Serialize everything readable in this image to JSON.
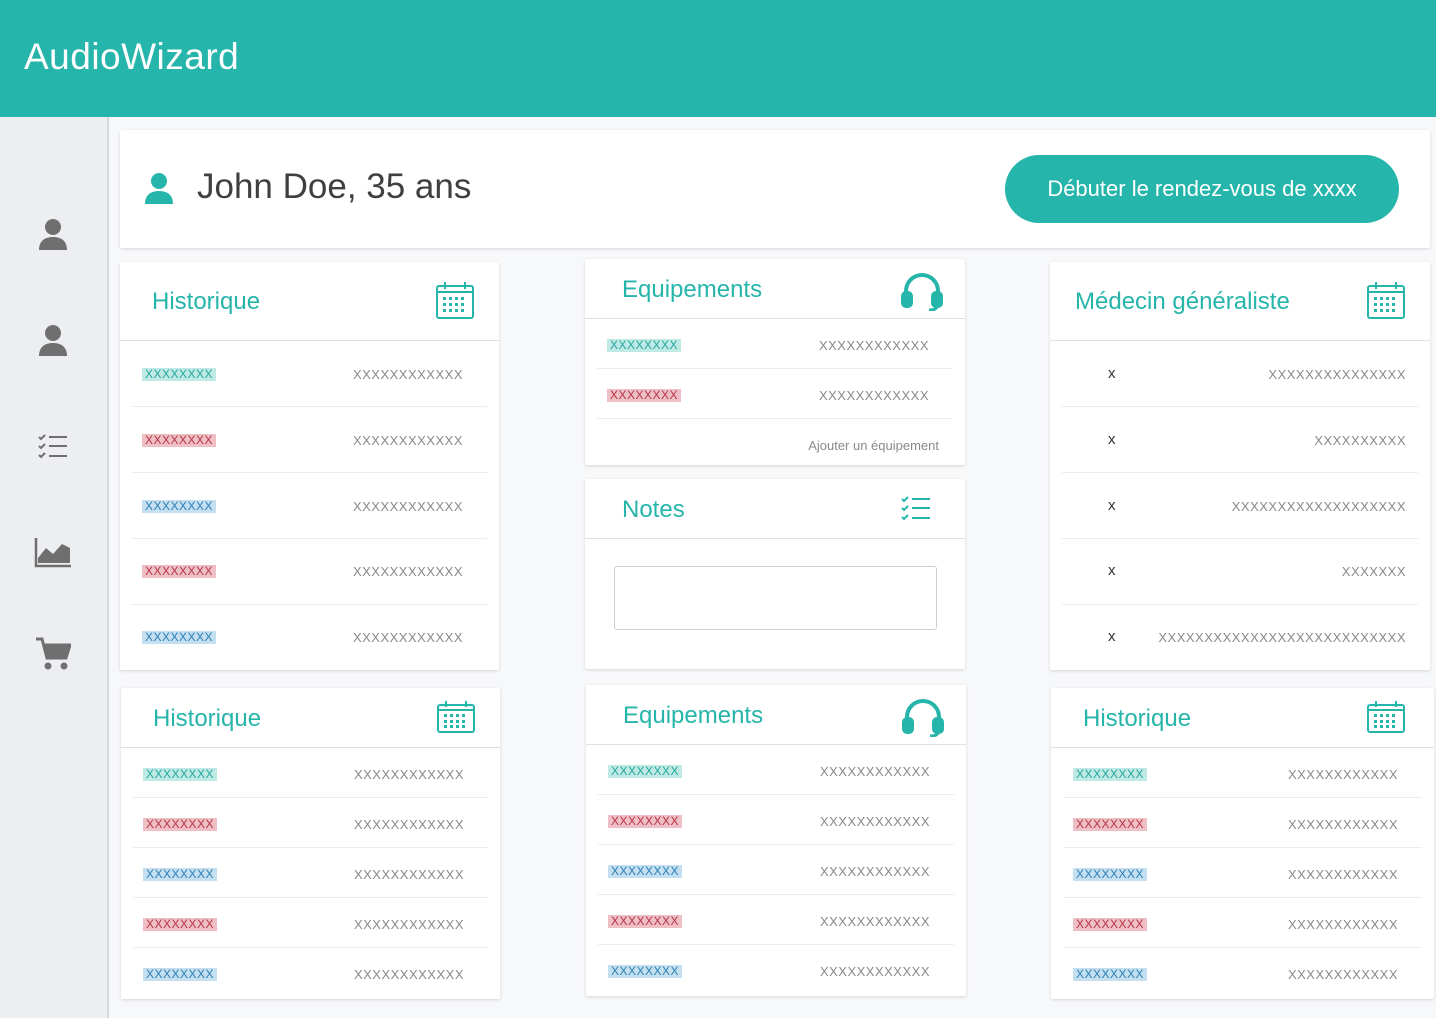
{
  "app": {
    "title": "AudioWizard"
  },
  "colors": {
    "accent": "#26b5aa",
    "tag_teal": "#24a79c",
    "tag_red": "#b83346",
    "tag_blue": "#2c7fb6"
  },
  "sidebar": {
    "items": [
      {
        "icon": "person-icon"
      },
      {
        "icon": "person-icon"
      },
      {
        "icon": "checklist-icon"
      },
      {
        "icon": "area-chart-icon"
      },
      {
        "icon": "cart-icon"
      }
    ]
  },
  "patient": {
    "name": "John Doe, 35 ans",
    "start_button": "Débuter le rendez-vous de xxxx"
  },
  "historique_top": {
    "title": "Historique",
    "rows": [
      {
        "tag": "XXXXXXXX",
        "color": "teal",
        "value": "XXXXXXXXXXXX"
      },
      {
        "tag": "XXXXXXXX",
        "color": "red",
        "value": "XXXXXXXXXXXX"
      },
      {
        "tag": "XXXXXXXX",
        "color": "blue",
        "value": "XXXXXXXXXXXX"
      },
      {
        "tag": "XXXXXXXX",
        "color": "red",
        "value": "XXXXXXXXXXXX"
      },
      {
        "tag": "XXXXXXXX",
        "color": "blue",
        "value": "XXXXXXXXXXXX"
      }
    ]
  },
  "equipements_top": {
    "title": "Equipements",
    "rows": [
      {
        "tag": "XXXXXXXX",
        "color": "teal",
        "value": "XXXXXXXXXXXX"
      },
      {
        "tag": "XXXXXXXX",
        "color": "red",
        "value": "XXXXXXXXXXXX"
      }
    ],
    "add_label": "Ajouter un équipement"
  },
  "notes": {
    "title": "Notes",
    "value": ""
  },
  "medecin": {
    "title": "Médecin généraliste",
    "rows": [
      {
        "label": "x",
        "value": "XXXXXXXXXXXXXXX"
      },
      {
        "label": "x",
        "value": "XXXXXXXXXX"
      },
      {
        "label": "x",
        "value": "XXXXXXXXXXXXXXXXXXX"
      },
      {
        "label": "x",
        "value": "XXXXXXX"
      },
      {
        "label": "x",
        "value": "XXXXXXXXXXXXXXXXXXXXXXXXXXX"
      }
    ]
  },
  "historique_bl": {
    "title": "Historique",
    "rows": [
      {
        "tag": "XXXXXXXX",
        "color": "teal",
        "value": "XXXXXXXXXXXX"
      },
      {
        "tag": "XXXXXXXX",
        "color": "red",
        "value": "XXXXXXXXXXXX"
      },
      {
        "tag": "XXXXXXXX",
        "color": "blue",
        "value": "XXXXXXXXXXXX"
      },
      {
        "tag": "XXXXXXXX",
        "color": "red",
        "value": "XXXXXXXXXXXX"
      },
      {
        "tag": "XXXXXXXX",
        "color": "blue",
        "value": "XXXXXXXXXXXX"
      }
    ]
  },
  "equipements_bottom": {
    "title": "Equipements",
    "rows": [
      {
        "tag": "XXXXXXXX",
        "color": "teal",
        "value": "XXXXXXXXXXXX"
      },
      {
        "tag": "XXXXXXXX",
        "color": "red",
        "value": "XXXXXXXXXXXX"
      },
      {
        "tag": "XXXXXXXX",
        "color": "blue",
        "value": "XXXXXXXXXXXX"
      },
      {
        "tag": "XXXXXXXX",
        "color": "red",
        "value": "XXXXXXXXXXXX"
      },
      {
        "tag": "XXXXXXXX",
        "color": "blue",
        "value": "XXXXXXXXXXXX"
      }
    ]
  },
  "historique_br": {
    "title": "Historique",
    "rows": [
      {
        "tag": "XXXXXXXX",
        "color": "teal",
        "value": "XXXXXXXXXXXX"
      },
      {
        "tag": "XXXXXXXX",
        "color": "red",
        "value": "XXXXXXXXXXXX"
      },
      {
        "tag": "XXXXXXXX",
        "color": "blue",
        "value": "XXXXXXXXXXXX"
      },
      {
        "tag": "XXXXXXXX",
        "color": "red",
        "value": "XXXXXXXXXXXX"
      },
      {
        "tag": "XXXXXXXX",
        "color": "blue",
        "value": "XXXXXXXXXXXX"
      }
    ]
  }
}
